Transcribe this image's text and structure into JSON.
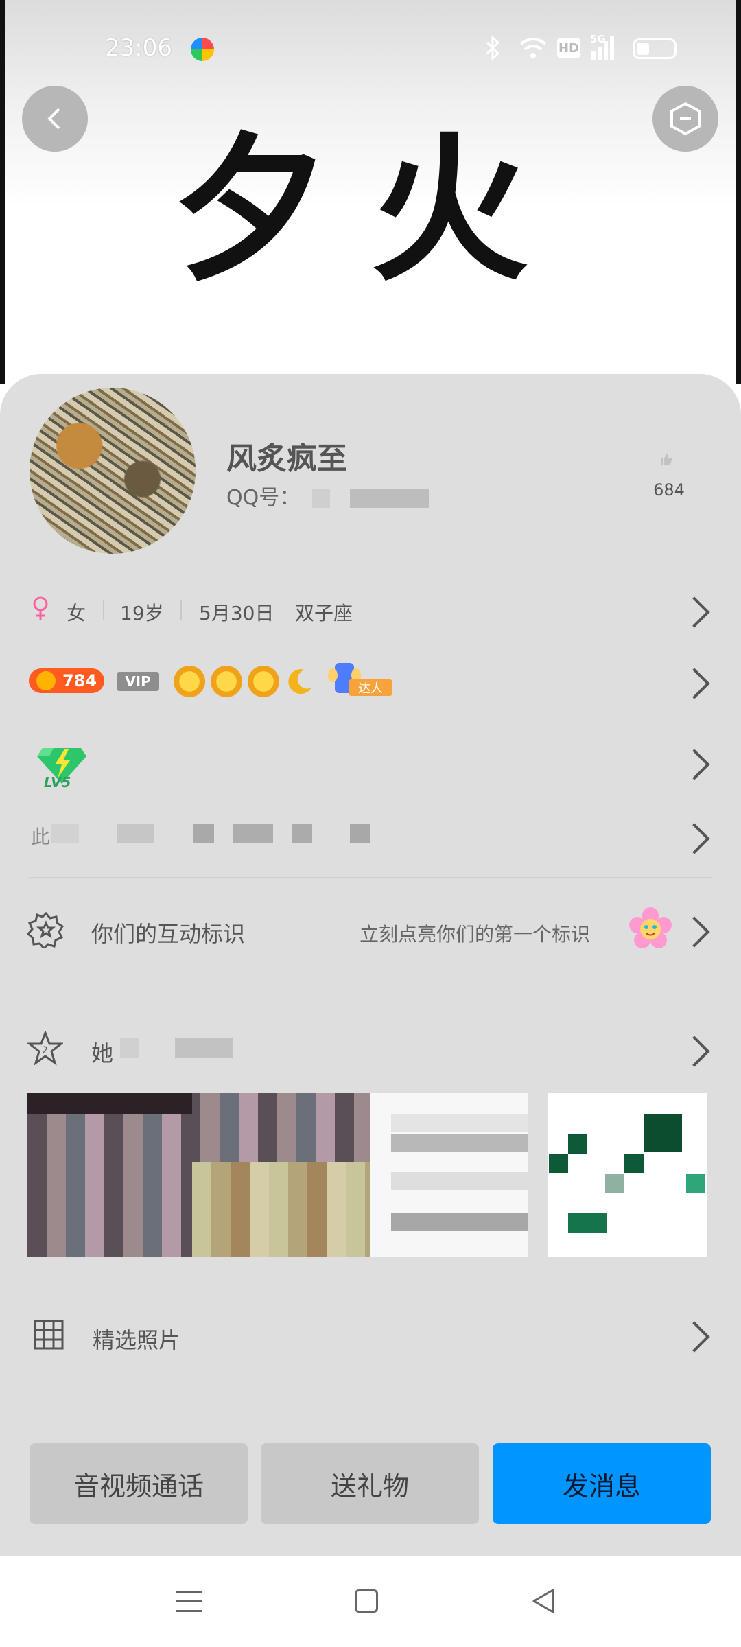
{
  "status_bar": {
    "time": "23:06",
    "icons": [
      "qq-logo-icon",
      "bluetooth-icon",
      "wifi-icon",
      "hd-icon",
      "5g-signal-icon",
      "battery-icon"
    ],
    "hd_label": "HD",
    "network_label": "5G"
  },
  "header": {
    "calligraphy": "夕火",
    "back_icon": "chevron-left-icon",
    "settings_icon": "hexagon-minus-icon"
  },
  "profile": {
    "name": "风炙疯至",
    "qq_label": "QQ号：",
    "likes": "684",
    "like_icon": "thumb-up-icon"
  },
  "info": {
    "gender": "女",
    "age": "19岁",
    "birthday": "5月30日",
    "zodiac": "双子座"
  },
  "level": {
    "points": "784",
    "vip_label": "VIP",
    "expert_label": "达人"
  },
  "level_badge": {
    "label": "LV5"
  },
  "signature": {
    "prefix": "此"
  },
  "interaction": {
    "label": "你们的互动标识",
    "hint": "立刻点亮你们的第一个标识"
  },
  "her_section": {
    "label": "她"
  },
  "featured": {
    "label": "精选照片"
  },
  "actions": {
    "call": "音视频通话",
    "gift": "送礼物",
    "message": "发消息"
  },
  "colors": {
    "primary": "#0095ff",
    "card_bg": "#dedede",
    "button_grey": "#c8c8c8",
    "points_orange": "#ff5a1f"
  }
}
